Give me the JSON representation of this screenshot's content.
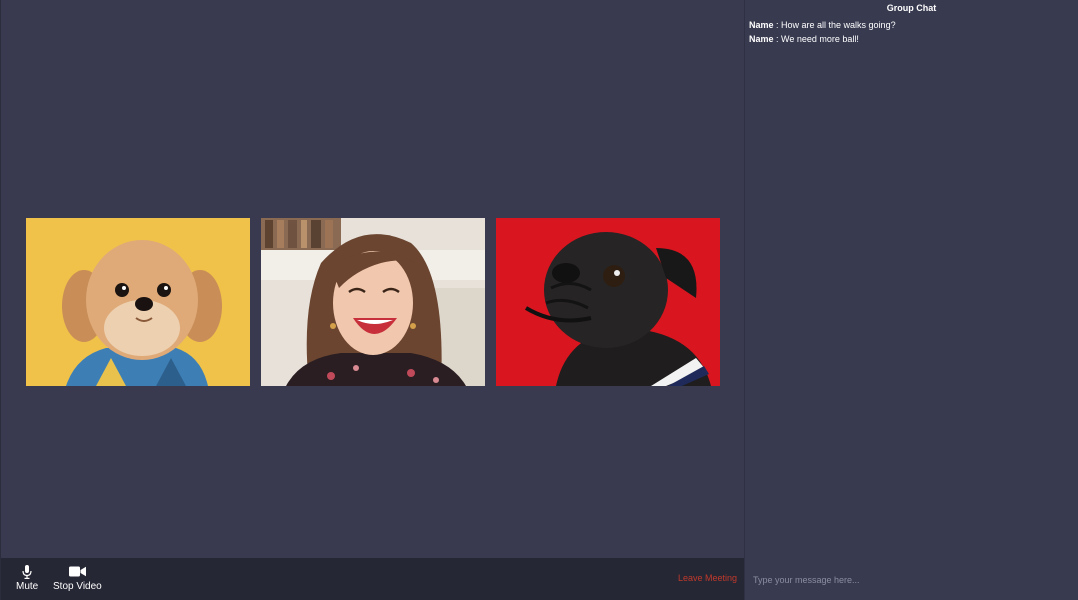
{
  "participants": [
    {
      "name": "Shih tzu dog on yellow background",
      "background": "#f0c24a"
    },
    {
      "name": "Laughing woman",
      "background": "#d9d2c8"
    },
    {
      "name": "Black pug on red background",
      "background": "#d9161f"
    }
  ],
  "controls": {
    "mute_label": "Mute",
    "video_label": "Stop Video",
    "leave_label": "Leave Meeting"
  },
  "chat": {
    "title": "Group Chat",
    "messages": [
      {
        "sender": "Name",
        "text": " : How are all the walks going?"
      },
      {
        "sender": "Name",
        "text": " : We need more ball!"
      }
    ],
    "input_placeholder": "Type your message here..."
  },
  "colors": {
    "main_bg": "#393a4f",
    "controls_bg": "#262735",
    "leave_color": "#c0392b"
  }
}
